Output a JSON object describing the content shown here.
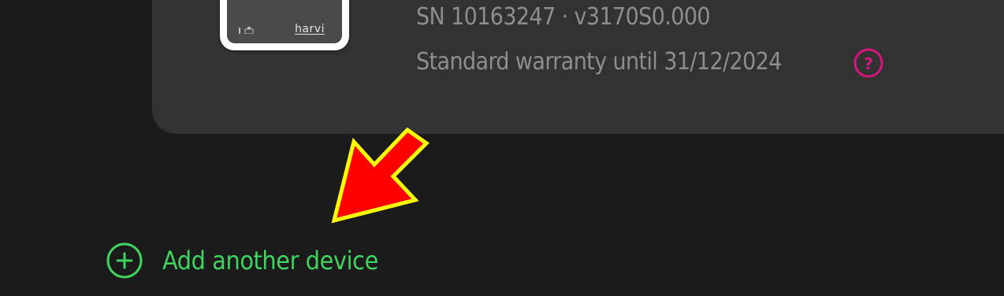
{
  "device": {
    "brand_logo_text": "harvi",
    "serial_line": "SN 10163247 · v3170S0.000",
    "warranty_line": "Standard warranty until 31/12/2024",
    "help_icon": "question-circle-icon"
  },
  "actions": {
    "add_device_label": "Add another device",
    "add_device_icon": "plus-circle-icon"
  },
  "annotation": {
    "arrow_icon": "red-arrow-pointer"
  },
  "colors": {
    "background": "#1b1b1b",
    "card": "#323232",
    "muted_text": "#8e8e8e",
    "accent_green": "#3ed45f",
    "help_magenta": "#d6157f",
    "arrow_red": "#ff0000",
    "arrow_outline": "#ffff00"
  }
}
